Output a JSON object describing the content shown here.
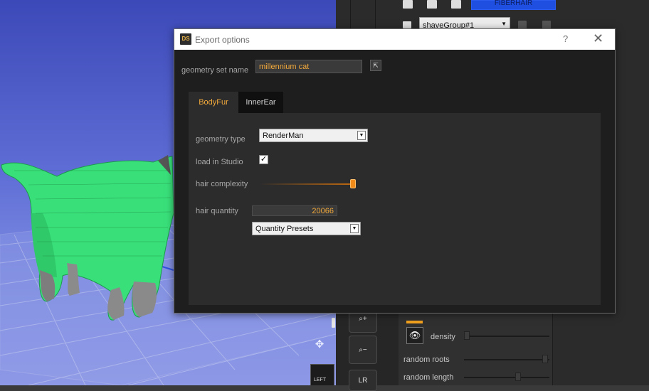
{
  "dialog": {
    "title": "Export options",
    "logo": "DS",
    "help": "?",
    "close": "✕",
    "geometry_set_label": "geometry set name",
    "geometry_set_value": "millennium cat",
    "tabs": [
      {
        "label": "BodyFur",
        "active": true
      },
      {
        "label": "InnerEar",
        "active": false
      }
    ],
    "geometry_type_label": "geometry type",
    "geometry_type_value": "RenderMan",
    "load_label": "load in Studio",
    "load_checked": true,
    "complexity_label": "hair complexity",
    "complexity_level": 1.0,
    "quantity_label": "hair quantity",
    "quantity_value": "20066",
    "quantity_presets": "Quantity Presets"
  },
  "background_panel": {
    "fiberhair_button": "FIBERHAIR",
    "shave_group": "shaveGroup#1",
    "density_label": "density",
    "random_roots_label": "random roots",
    "random_length_label": "random length",
    "lr_button": "LR"
  },
  "viewport": {
    "cube_label": "LEFT"
  },
  "colors": {
    "accent_orange": "#f2a93b",
    "fur_green": "#39e07a",
    "viewport_blue": "#5f6ed6",
    "fiber_blue": "#1f4fe0"
  },
  "icons": [
    "close-icon",
    "help-icon",
    "add-icon",
    "gear-icon",
    "eye-icon",
    "zoom-in-icon",
    "zoom-out-icon",
    "pan-icon",
    "checkmark-icon",
    "dropdown-arrow-icon"
  ]
}
